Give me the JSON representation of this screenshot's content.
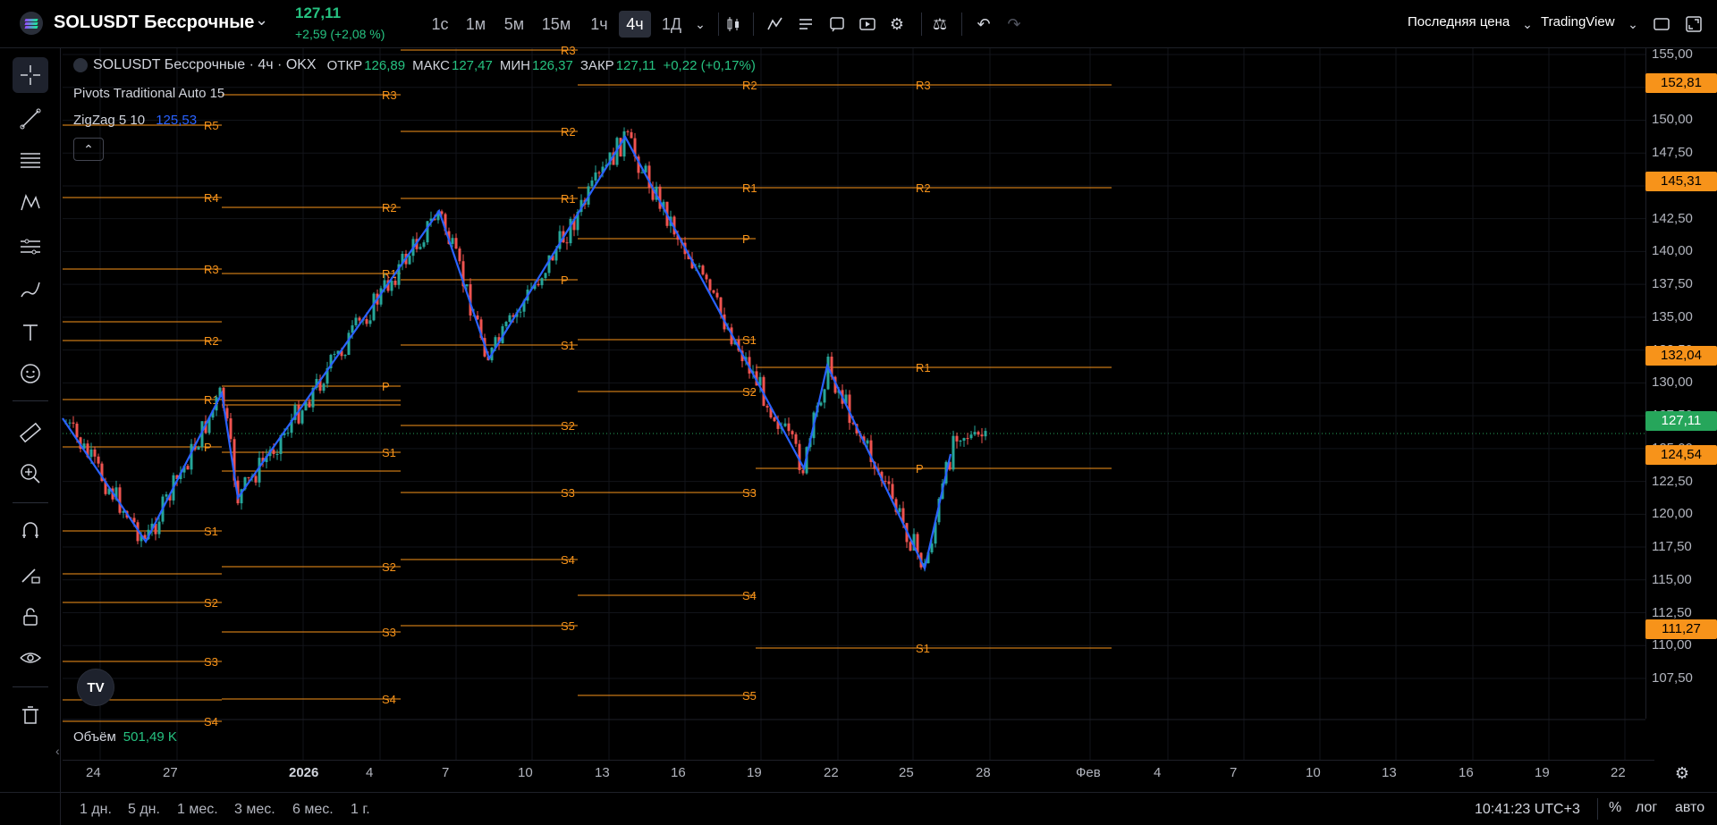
{
  "header": {
    "symbol": "SOLUSDT Бессрочные",
    "price": "127,11",
    "change": "+2,59 (+2,08 %)",
    "timeframes": [
      "1с",
      "1м",
      "5м",
      "15м",
      "1ч",
      "4ч",
      "1Д"
    ],
    "active_timeframe": "4ч",
    "price_source": "Последняя цена",
    "provider": "TradingView"
  },
  "legend": {
    "title": "SOLUSDT Бессрочные · 4ч · OKX",
    "open_label": "ОТКР",
    "open": "126,89",
    "high_label": "МАКС",
    "high": "127,47",
    "low_label": "МИН",
    "low": "126,37",
    "close_label": "ЗАКР",
    "close": "127,11",
    "change": "+0,22 (+0,17%)"
  },
  "indicators": {
    "pivots": "Pivots Traditional Auto 15",
    "zigzag_label": "ZigZag 5 10",
    "zigzag_value": "125,53"
  },
  "volume": {
    "label": "Объём",
    "value": "501,49 K"
  },
  "price_axis": {
    "labels": [
      "155,00",
      "152,50",
      "150,00",
      "147,50",
      "145,00",
      "142,50",
      "140,00",
      "137,50",
      "135,00",
      "132,50",
      "130,00",
      "127,50",
      "125,00",
      "122,50",
      "120,00",
      "117,50",
      "115,00",
      "112,50",
      "110,00",
      "107,50"
    ],
    "tags": [
      {
        "value": "152,81",
        "color": "#f7931a"
      },
      {
        "value": "145,31",
        "color": "#f7931a"
      },
      {
        "value": "132,04",
        "color": "#f7931a"
      },
      {
        "value": "127,11",
        "color": "#26a65b"
      },
      {
        "value": "124,54",
        "color": "#f7931a"
      },
      {
        "value": "111,27",
        "color": "#f7931a"
      }
    ]
  },
  "time_axis": [
    "24",
    "27",
    "2026",
    "4",
    "7",
    "10",
    "13",
    "16",
    "19",
    "22",
    "25",
    "28",
    "Фев",
    "4",
    "7",
    "10",
    "13",
    "16",
    "19",
    "22"
  ],
  "range_buttons": [
    "1 дн.",
    "5 дн.",
    "1 мес.",
    "3 мес.",
    "6 мес.",
    "1 г."
  ],
  "clock": "10:41:23 UTC+3",
  "bottom_right": [
    "%",
    "лог",
    "авто"
  ],
  "pivot_labels": [
    "R5",
    "R4",
    "R3",
    "R2",
    "R1",
    "P",
    "S1",
    "S2",
    "S3",
    "S4",
    "S5"
  ],
  "colors": {
    "pivot": "#f7931a",
    "zigzag": "#2962ff",
    "up": "#26a69a",
    "down": "#ef5350",
    "accent_green": "#26c281"
  }
}
